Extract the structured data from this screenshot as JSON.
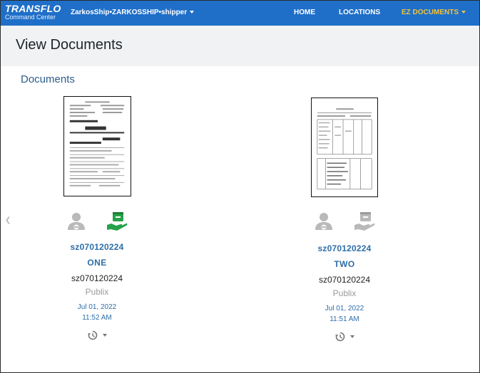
{
  "brand": {
    "name": "TRANSFLO",
    "subtitle": "Command Center"
  },
  "account": {
    "label": "ZarkosShip•ZARKOSSHIP•shipper"
  },
  "nav": {
    "home": "HOME",
    "locations": "LOCATIONS",
    "ez_documents": "EZ DOCUMENTS"
  },
  "page": {
    "title": "View Documents",
    "section_title": "Documents"
  },
  "documents": [
    {
      "link": "sz070120224",
      "type": "ONE",
      "reference": "sz070120224",
      "shipper": "Publix",
      "date": "Jul 01, 2022",
      "time": "11:52 AM",
      "delivered_icon": "hand-box-icon-active"
    },
    {
      "link": "sz070120224",
      "type": "TWO",
      "reference": "sz070120224",
      "shipper": "Publix",
      "date": "Jul 01, 2022",
      "time": "11:51 AM",
      "delivered_icon": "hand-box-icon-inactive"
    }
  ],
  "colors": {
    "nav_bg": "#1f6fc9",
    "nav_active": "#f3c33b",
    "link": "#2d6ea8",
    "delivered_green": "#27a24a",
    "icon_gray": "#b9b9b9"
  }
}
